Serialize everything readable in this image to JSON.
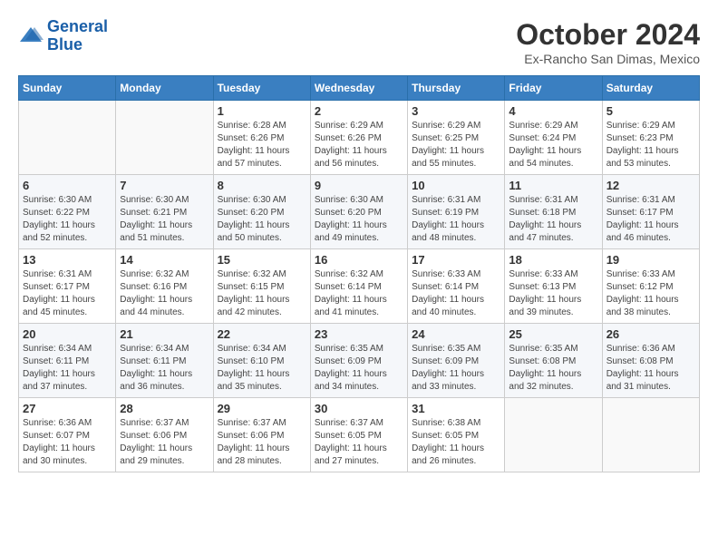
{
  "logo": {
    "line1": "General",
    "line2": "Blue"
  },
  "title": "October 2024",
  "location": "Ex-Rancho San Dimas, Mexico",
  "weekdays": [
    "Sunday",
    "Monday",
    "Tuesday",
    "Wednesday",
    "Thursday",
    "Friday",
    "Saturday"
  ],
  "weeks": [
    [
      {
        "day": "",
        "info": ""
      },
      {
        "day": "",
        "info": ""
      },
      {
        "day": "1",
        "info": "Sunrise: 6:28 AM\nSunset: 6:26 PM\nDaylight: 11 hours and 57 minutes."
      },
      {
        "day": "2",
        "info": "Sunrise: 6:29 AM\nSunset: 6:26 PM\nDaylight: 11 hours and 56 minutes."
      },
      {
        "day": "3",
        "info": "Sunrise: 6:29 AM\nSunset: 6:25 PM\nDaylight: 11 hours and 55 minutes."
      },
      {
        "day": "4",
        "info": "Sunrise: 6:29 AM\nSunset: 6:24 PM\nDaylight: 11 hours and 54 minutes."
      },
      {
        "day": "5",
        "info": "Sunrise: 6:29 AM\nSunset: 6:23 PM\nDaylight: 11 hours and 53 minutes."
      }
    ],
    [
      {
        "day": "6",
        "info": "Sunrise: 6:30 AM\nSunset: 6:22 PM\nDaylight: 11 hours and 52 minutes."
      },
      {
        "day": "7",
        "info": "Sunrise: 6:30 AM\nSunset: 6:21 PM\nDaylight: 11 hours and 51 minutes."
      },
      {
        "day": "8",
        "info": "Sunrise: 6:30 AM\nSunset: 6:20 PM\nDaylight: 11 hours and 50 minutes."
      },
      {
        "day": "9",
        "info": "Sunrise: 6:30 AM\nSunset: 6:20 PM\nDaylight: 11 hours and 49 minutes."
      },
      {
        "day": "10",
        "info": "Sunrise: 6:31 AM\nSunset: 6:19 PM\nDaylight: 11 hours and 48 minutes."
      },
      {
        "day": "11",
        "info": "Sunrise: 6:31 AM\nSunset: 6:18 PM\nDaylight: 11 hours and 47 minutes."
      },
      {
        "day": "12",
        "info": "Sunrise: 6:31 AM\nSunset: 6:17 PM\nDaylight: 11 hours and 46 minutes."
      }
    ],
    [
      {
        "day": "13",
        "info": "Sunrise: 6:31 AM\nSunset: 6:17 PM\nDaylight: 11 hours and 45 minutes."
      },
      {
        "day": "14",
        "info": "Sunrise: 6:32 AM\nSunset: 6:16 PM\nDaylight: 11 hours and 44 minutes."
      },
      {
        "day": "15",
        "info": "Sunrise: 6:32 AM\nSunset: 6:15 PM\nDaylight: 11 hours and 42 minutes."
      },
      {
        "day": "16",
        "info": "Sunrise: 6:32 AM\nSunset: 6:14 PM\nDaylight: 11 hours and 41 minutes."
      },
      {
        "day": "17",
        "info": "Sunrise: 6:33 AM\nSunset: 6:14 PM\nDaylight: 11 hours and 40 minutes."
      },
      {
        "day": "18",
        "info": "Sunrise: 6:33 AM\nSunset: 6:13 PM\nDaylight: 11 hours and 39 minutes."
      },
      {
        "day": "19",
        "info": "Sunrise: 6:33 AM\nSunset: 6:12 PM\nDaylight: 11 hours and 38 minutes."
      }
    ],
    [
      {
        "day": "20",
        "info": "Sunrise: 6:34 AM\nSunset: 6:11 PM\nDaylight: 11 hours and 37 minutes."
      },
      {
        "day": "21",
        "info": "Sunrise: 6:34 AM\nSunset: 6:11 PM\nDaylight: 11 hours and 36 minutes."
      },
      {
        "day": "22",
        "info": "Sunrise: 6:34 AM\nSunset: 6:10 PM\nDaylight: 11 hours and 35 minutes."
      },
      {
        "day": "23",
        "info": "Sunrise: 6:35 AM\nSunset: 6:09 PM\nDaylight: 11 hours and 34 minutes."
      },
      {
        "day": "24",
        "info": "Sunrise: 6:35 AM\nSunset: 6:09 PM\nDaylight: 11 hours and 33 minutes."
      },
      {
        "day": "25",
        "info": "Sunrise: 6:35 AM\nSunset: 6:08 PM\nDaylight: 11 hours and 32 minutes."
      },
      {
        "day": "26",
        "info": "Sunrise: 6:36 AM\nSunset: 6:08 PM\nDaylight: 11 hours and 31 minutes."
      }
    ],
    [
      {
        "day": "27",
        "info": "Sunrise: 6:36 AM\nSunset: 6:07 PM\nDaylight: 11 hours and 30 minutes."
      },
      {
        "day": "28",
        "info": "Sunrise: 6:37 AM\nSunset: 6:06 PM\nDaylight: 11 hours and 29 minutes."
      },
      {
        "day": "29",
        "info": "Sunrise: 6:37 AM\nSunset: 6:06 PM\nDaylight: 11 hours and 28 minutes."
      },
      {
        "day": "30",
        "info": "Sunrise: 6:37 AM\nSunset: 6:05 PM\nDaylight: 11 hours and 27 minutes."
      },
      {
        "day": "31",
        "info": "Sunrise: 6:38 AM\nSunset: 6:05 PM\nDaylight: 11 hours and 26 minutes."
      },
      {
        "day": "",
        "info": ""
      },
      {
        "day": "",
        "info": ""
      }
    ]
  ]
}
